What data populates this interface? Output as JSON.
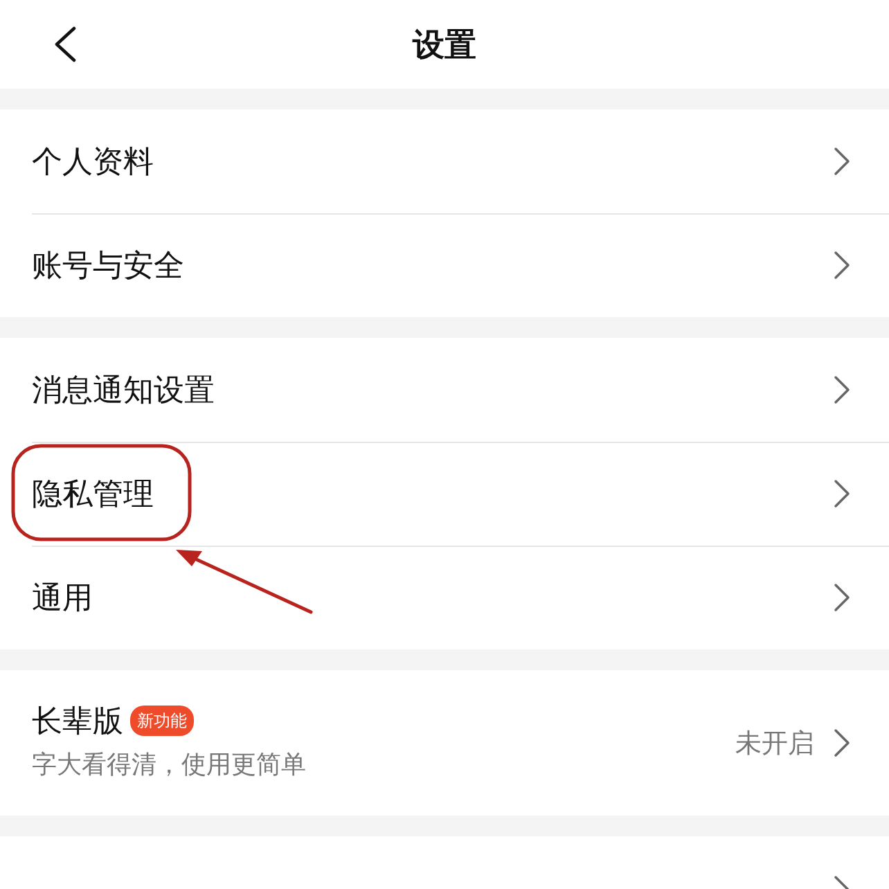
{
  "header": {
    "title": "设置"
  },
  "groups": [
    {
      "items": [
        {
          "label": "个人资料",
          "highlighted": false
        },
        {
          "label": "账号与安全",
          "highlighted": false
        }
      ]
    },
    {
      "items": [
        {
          "label": "消息通知设置",
          "highlighted": false
        },
        {
          "label": "隐私管理",
          "highlighted": true
        },
        {
          "label": "通用",
          "highlighted": false
        }
      ]
    },
    {
      "items": [
        {
          "label": "长辈版",
          "badge": "新功能",
          "subtitle": "字大看得清，使用更简单",
          "value": "未开启",
          "highlighted": false
        }
      ]
    },
    {
      "items": [
        {
          "highlighted": false
        }
      ]
    }
  ]
}
